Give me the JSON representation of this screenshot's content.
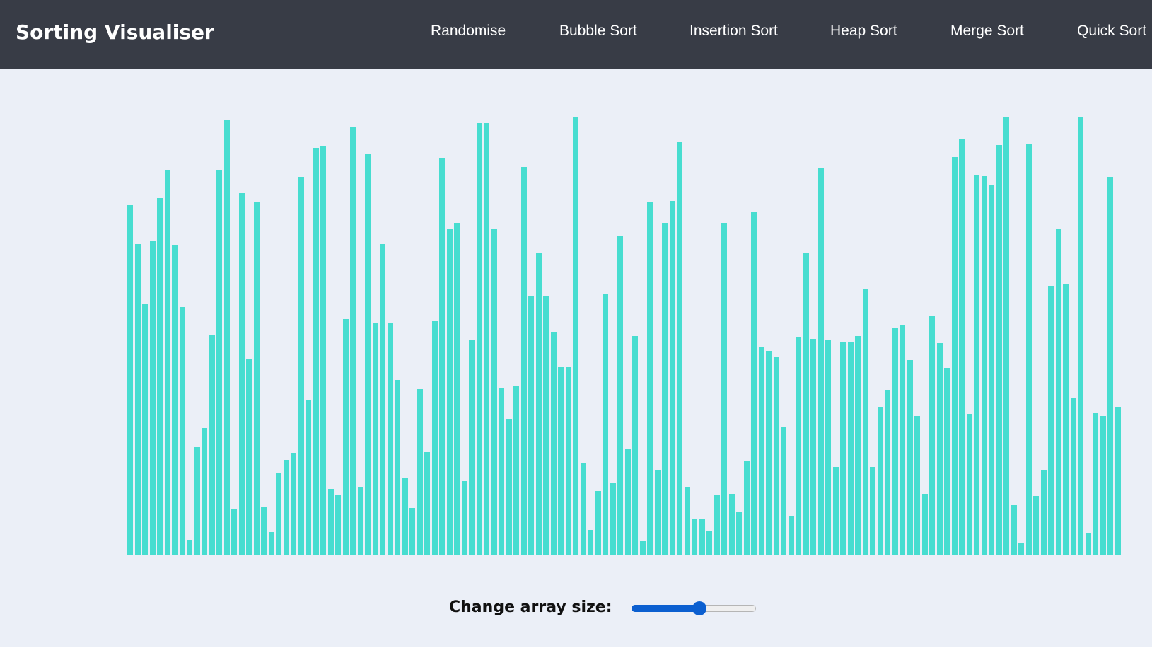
{
  "header": {
    "title": "Sorting Visualiser",
    "nav": {
      "randomise": "Randomise",
      "bubble_sort": "Bubble Sort",
      "insertion_sort": "Insertion Sort",
      "heap_sort": "Heap Sort",
      "merge_sort": "Merge Sort",
      "quick_sort": "Quick Sort"
    }
  },
  "colors": {
    "navbar": "#383c46",
    "background": "#ebeff7",
    "bar": "#47ddd0",
    "slider_accent": "#0b5fd0"
  },
  "controls": {
    "array_size_label": "Change array size:",
    "array_size_fraction": 0.55
  },
  "chart_data": {
    "type": "bar",
    "ylim": [
      0,
      620
    ],
    "values": [
      495,
      440,
      355,
      445,
      505,
      545,
      438,
      351,
      22,
      153,
      180,
      312,
      544,
      615,
      65,
      512,
      277,
      500,
      68,
      33,
      116,
      135,
      145,
      535,
      219,
      576,
      578,
      94,
      85,
      334,
      605,
      97,
      567,
      329,
      440,
      329,
      248,
      110,
      67,
      235,
      146,
      331,
      562,
      461,
      470,
      105,
      305,
      611,
      611,
      461,
      236,
      193,
      240,
      549,
      367,
      427,
      367,
      315,
      266,
      266,
      619,
      131,
      36,
      91,
      369,
      102,
      452,
      151,
      310,
      20,
      500,
      120,
      470,
      501,
      584,
      96,
      52,
      52,
      35,
      85,
      470,
      87,
      61,
      134,
      486,
      294,
      289,
      281,
      181,
      56,
      308,
      428,
      306,
      548,
      304,
      125,
      301,
      301,
      310,
      376,
      125,
      210,
      233,
      321,
      325,
      276,
      197,
      86,
      339,
      300,
      265,
      563,
      589,
      200,
      538,
      536,
      524,
      580,
      620,
      71,
      18,
      582,
      84,
      120,
      381,
      461,
      384,
      223,
      620,
      31,
      201,
      197,
      535,
      210
    ]
  }
}
